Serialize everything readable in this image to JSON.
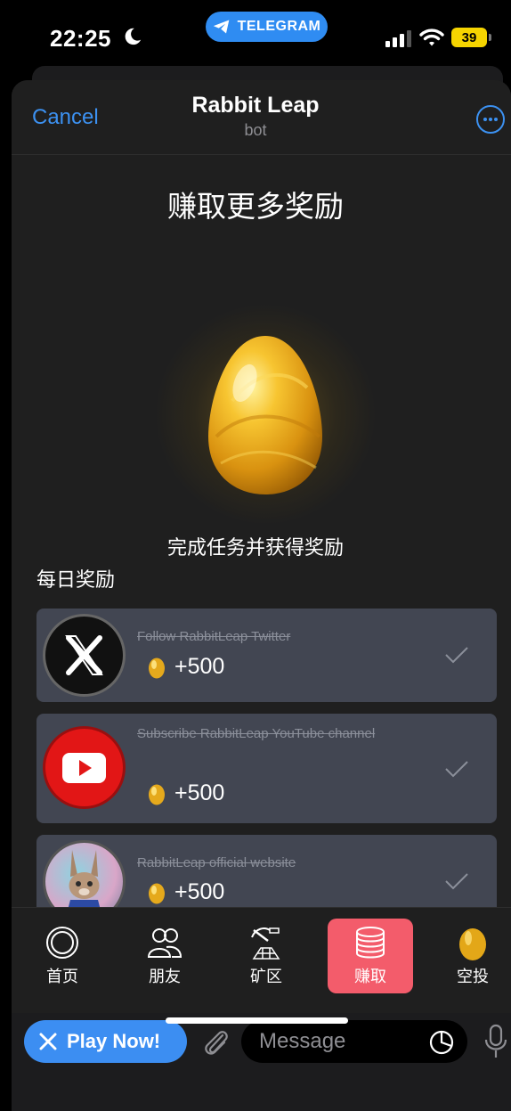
{
  "status_bar": {
    "time": "22:25",
    "pill_label": "TELEGRAM",
    "battery": "39",
    "battery_color": "#f5d400"
  },
  "header": {
    "cancel": "Cancel",
    "title": "Rabbit Leap",
    "subtitle": "bot",
    "more_icon": "ellipsis-circle-icon"
  },
  "main": {
    "heading": "赚取更多奖励",
    "tagline": "完成任务并获得奖励",
    "section_title": "每日奖励",
    "tasks": [
      {
        "title": "Follow RabbitLeap Twitter",
        "reward": "+500",
        "icon": "x-logo-icon",
        "completed": true
      },
      {
        "title": "Subscribe RabbitLeap YouTube channel",
        "reward": "+500",
        "icon": "youtube-logo-icon",
        "completed": true
      },
      {
        "title": "RabbitLeap official website",
        "reward": "+500",
        "icon": "rabbit-avatar-icon",
        "completed": true
      }
    ]
  },
  "nav": {
    "items": [
      {
        "label": "首页",
        "icon": "circle-home-icon",
        "active": false
      },
      {
        "label": "朋友",
        "icon": "friends-icon",
        "active": false
      },
      {
        "label": "矿区",
        "icon": "pickaxe-icon",
        "active": false
      },
      {
        "label": "赚取",
        "icon": "coins-stack-icon",
        "active": true
      },
      {
        "label": "空投",
        "icon": "golden-egg-icon",
        "active": false
      }
    ],
    "active_color": "#f35c6b"
  },
  "message_bar": {
    "play_button": "Play Now!",
    "placeholder": "Message",
    "accent": "#3c8ef2"
  }
}
